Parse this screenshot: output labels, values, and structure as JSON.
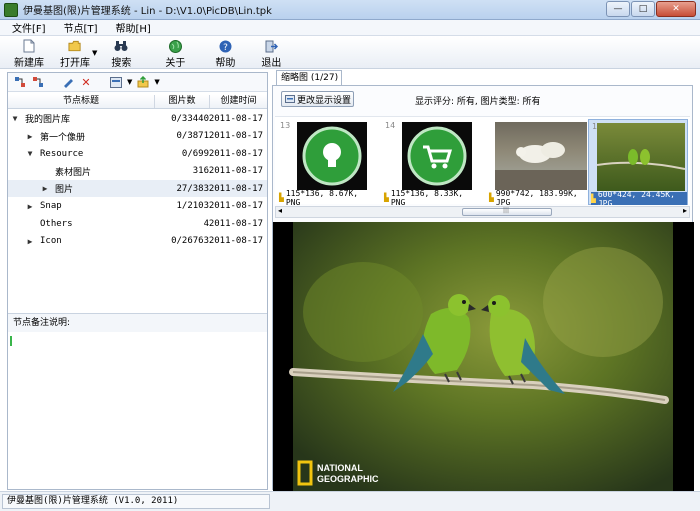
{
  "window": {
    "title": "伊曼基图(限)片管理系统 - Lin - D:\\V1.0\\PicDB\\Lin.tpk",
    "minimize": "—",
    "maximize": "□",
    "close": "✕"
  },
  "menu": [
    "文件[F]",
    "节点[T]",
    "帮助[H]"
  ],
  "toolbar": {
    "new": "新建库",
    "open": "打开库",
    "search": "搜索",
    "about": "关于",
    "help": "帮助",
    "exit": "退出"
  },
  "tree": {
    "headers": [
      "节点标题",
      "图片数",
      "创建时间"
    ],
    "rows": [
      {
        "label": "我的图片库",
        "count": "0/33440",
        "date": "2011-08-17",
        "expander": "▼",
        "indent": 0
      },
      {
        "label": "第一个像册",
        "count": "0/3871",
        "date": "2011-08-17",
        "expander": "▶",
        "indent": 1
      },
      {
        "label": "Resource",
        "count": "0/699",
        "date": "2011-08-17",
        "expander": "▼",
        "indent": 1
      },
      {
        "label": "素材图片",
        "count": "316",
        "date": "2011-08-17",
        "expander": "",
        "indent": 2
      },
      {
        "label": "图片",
        "count": "27/383",
        "date": "2011-08-17",
        "expander": "▶",
        "indent": 2
      },
      {
        "label": "Snap",
        "count": "1/2103",
        "date": "2011-08-17",
        "expander": "▶",
        "indent": 1
      },
      {
        "label": "Others",
        "count": "4",
        "date": "2011-08-17",
        "expander": "",
        "indent": 1
      },
      {
        "label": "Icon",
        "count": "0/26763",
        "date": "2011-08-17",
        "expander": "▶",
        "indent": 1
      }
    ]
  },
  "notes": {
    "title": "节点备注说明:"
  },
  "tab": {
    "label": "缩略图 (1/27)"
  },
  "settings_button": "更改显示设置",
  "filter": "显示评分: 所有, 图片类型: 所有",
  "thumbs": [
    {
      "num": "13",
      "caption": "115*136, 8.67K, PNG"
    },
    {
      "num": "14",
      "caption": "115*136, 8.33K, PNG"
    },
    {
      "num": "",
      "caption": "990*742, 183.99K, JPG"
    },
    {
      "num": "16",
      "caption": "600*424, 24.45K, JPG"
    }
  ],
  "preview": {
    "watermark_line1": "NATIONAL",
    "watermark_line2": "GEOGRAPHIC"
  },
  "status": "伊曼基图(限)片管理系统 (V1.0, 2011)",
  "colors": {
    "icon_green": "#2f9e3a",
    "selection": "#cfe0f5",
    "accent_blue": "#3a6fb5"
  }
}
